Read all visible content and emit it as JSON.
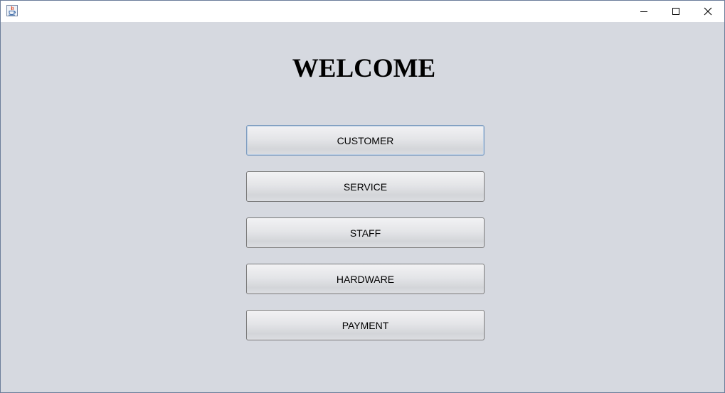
{
  "window": {
    "icon": "java-cup-icon",
    "controls": {
      "minimize_icon": "minimize-icon",
      "maximize_icon": "maximize-icon",
      "close_icon": "close-icon"
    }
  },
  "main": {
    "title": "WELCOME",
    "buttons": [
      {
        "label": "CUSTOMER",
        "focused": true
      },
      {
        "label": "SERVICE",
        "focused": false
      },
      {
        "label": "STAFF",
        "focused": false
      },
      {
        "label": "HARDWARE",
        "focused": false
      },
      {
        "label": "PAYMENT",
        "focused": false
      }
    ]
  },
  "colors": {
    "background": "#d6d9e0",
    "titlebar": "#ffffff",
    "focus_border": "#7e9dc0"
  }
}
